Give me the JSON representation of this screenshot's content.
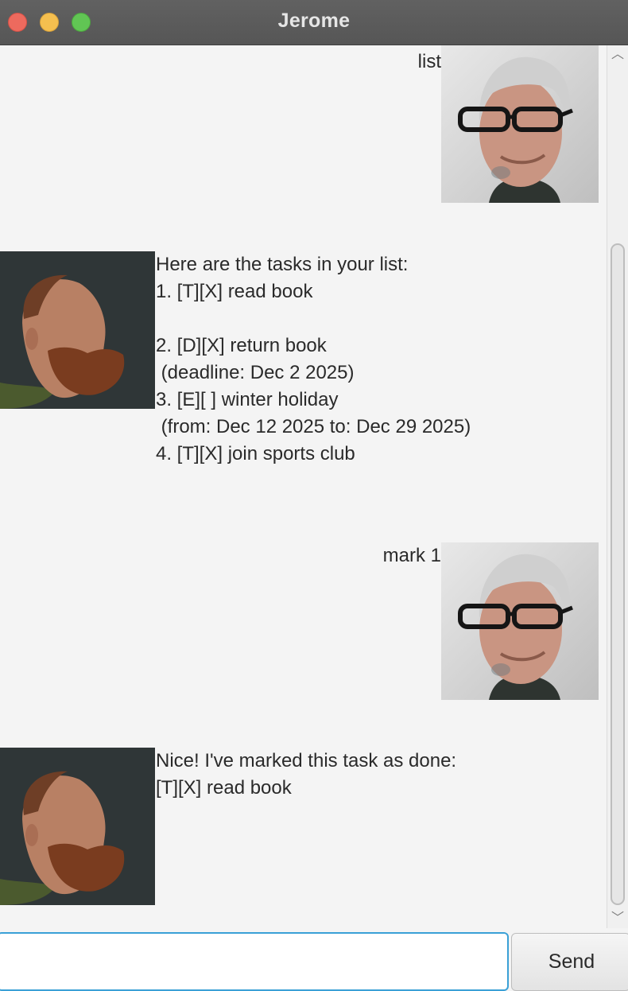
{
  "window": {
    "title": "Jerome",
    "controls": [
      "close",
      "minimize",
      "maximize"
    ]
  },
  "messages": [
    {
      "sender": "user",
      "avatar": "user-avatar",
      "text": "list"
    },
    {
      "sender": "bot",
      "avatar": "bot-avatar",
      "text": "Here are the tasks in your list:\n1. [T][X] read book\n\n2. [D][X] return book\n (deadline: Dec 2 2025)\n3. [E][ ] winter holiday\n (from: Dec 12 2025 to: Dec 29 2025)\n4. [T][X] join sports club"
    },
    {
      "sender": "user",
      "avatar": "user-avatar",
      "text": "mark 1"
    },
    {
      "sender": "bot",
      "avatar": "bot-avatar",
      "text": "Nice! I've marked this task as done:\n[T][X] read book"
    }
  ],
  "input": {
    "value": "",
    "placeholder": ""
  },
  "send_button": {
    "label": "Send"
  },
  "scrollbar": {
    "up_icon": "chevron-up-icon",
    "down_icon": "chevron-down-icon"
  },
  "colors": {
    "titlebar": "#5a5a5a",
    "input_focus": "#3aa0d6",
    "background": "#f4f4f4"
  }
}
